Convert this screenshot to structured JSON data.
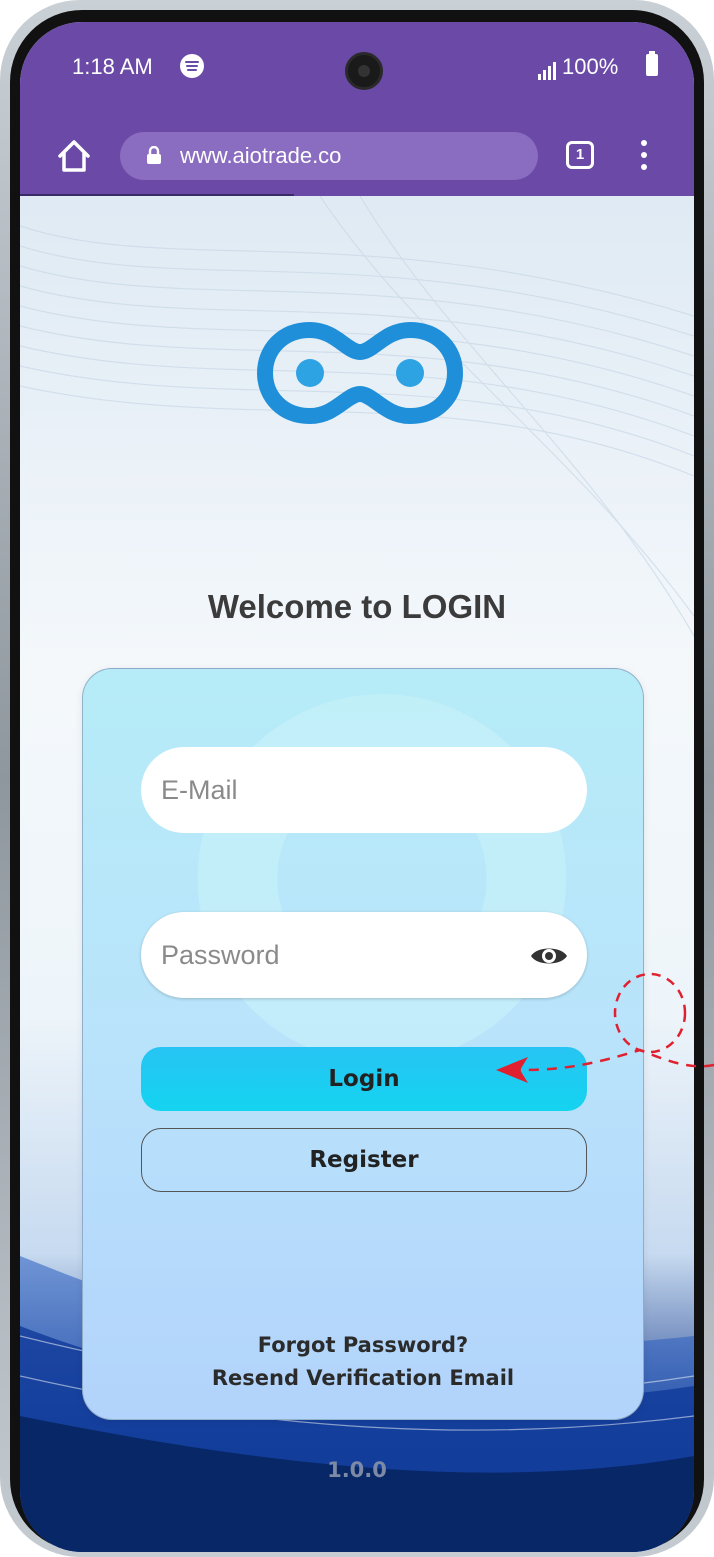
{
  "status_bar": {
    "time": "1:18 AM",
    "battery": "100%"
  },
  "browser": {
    "url": "www.aiotrade.co",
    "tab_count": "1"
  },
  "login": {
    "title": "Welcome to LOGIN",
    "email_placeholder": "E-Mail",
    "password_placeholder": "Password",
    "login_label": "Login",
    "register_label": "Register",
    "forgot_password_label": "Forgot Password?",
    "resend_verification_label": "Resend Verification Email",
    "version": "1.0.0"
  },
  "colors": {
    "browser_bar": "#6a4aa6",
    "login_button": "#14d4f0",
    "logo_blue": "#1f8fd9",
    "annotation_red": "#e0202e"
  },
  "icons": [
    "home-icon",
    "lock-icon",
    "tabs-icon",
    "menu-icon",
    "eye-icon",
    "spotify-icon",
    "signal-icon",
    "battery-icon"
  ]
}
